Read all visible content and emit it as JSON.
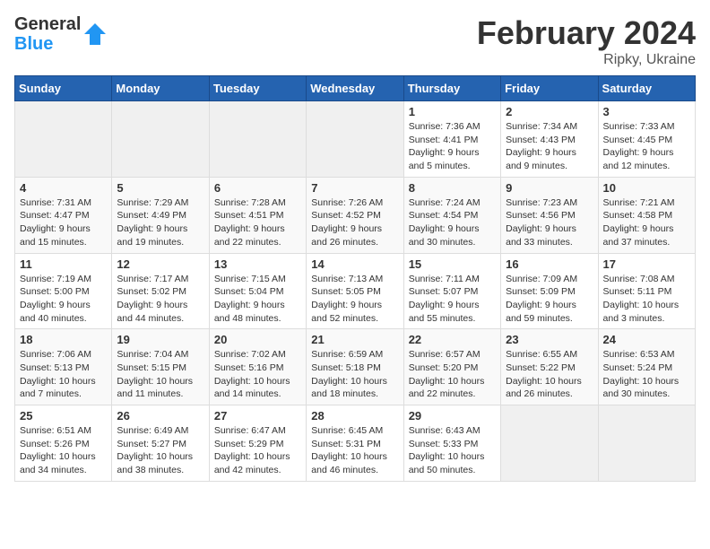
{
  "header": {
    "logo_general": "General",
    "logo_blue": "Blue",
    "title": "February 2024",
    "location": "Ripky, Ukraine"
  },
  "calendar": {
    "days_of_week": [
      "Sunday",
      "Monday",
      "Tuesday",
      "Wednesday",
      "Thursday",
      "Friday",
      "Saturday"
    ],
    "weeks": [
      [
        {
          "day": "",
          "info": ""
        },
        {
          "day": "",
          "info": ""
        },
        {
          "day": "",
          "info": ""
        },
        {
          "day": "",
          "info": ""
        },
        {
          "day": "1",
          "info": "Sunrise: 7:36 AM\nSunset: 4:41 PM\nDaylight: 9 hours\nand 5 minutes."
        },
        {
          "day": "2",
          "info": "Sunrise: 7:34 AM\nSunset: 4:43 PM\nDaylight: 9 hours\nand 9 minutes."
        },
        {
          "day": "3",
          "info": "Sunrise: 7:33 AM\nSunset: 4:45 PM\nDaylight: 9 hours\nand 12 minutes."
        }
      ],
      [
        {
          "day": "4",
          "info": "Sunrise: 7:31 AM\nSunset: 4:47 PM\nDaylight: 9 hours\nand 15 minutes."
        },
        {
          "day": "5",
          "info": "Sunrise: 7:29 AM\nSunset: 4:49 PM\nDaylight: 9 hours\nand 19 minutes."
        },
        {
          "day": "6",
          "info": "Sunrise: 7:28 AM\nSunset: 4:51 PM\nDaylight: 9 hours\nand 22 minutes."
        },
        {
          "day": "7",
          "info": "Sunrise: 7:26 AM\nSunset: 4:52 PM\nDaylight: 9 hours\nand 26 minutes."
        },
        {
          "day": "8",
          "info": "Sunrise: 7:24 AM\nSunset: 4:54 PM\nDaylight: 9 hours\nand 30 minutes."
        },
        {
          "day": "9",
          "info": "Sunrise: 7:23 AM\nSunset: 4:56 PM\nDaylight: 9 hours\nand 33 minutes."
        },
        {
          "day": "10",
          "info": "Sunrise: 7:21 AM\nSunset: 4:58 PM\nDaylight: 9 hours\nand 37 minutes."
        }
      ],
      [
        {
          "day": "11",
          "info": "Sunrise: 7:19 AM\nSunset: 5:00 PM\nDaylight: 9 hours\nand 40 minutes."
        },
        {
          "day": "12",
          "info": "Sunrise: 7:17 AM\nSunset: 5:02 PM\nDaylight: 9 hours\nand 44 minutes."
        },
        {
          "day": "13",
          "info": "Sunrise: 7:15 AM\nSunset: 5:04 PM\nDaylight: 9 hours\nand 48 minutes."
        },
        {
          "day": "14",
          "info": "Sunrise: 7:13 AM\nSunset: 5:05 PM\nDaylight: 9 hours\nand 52 minutes."
        },
        {
          "day": "15",
          "info": "Sunrise: 7:11 AM\nSunset: 5:07 PM\nDaylight: 9 hours\nand 55 minutes."
        },
        {
          "day": "16",
          "info": "Sunrise: 7:09 AM\nSunset: 5:09 PM\nDaylight: 9 hours\nand 59 minutes."
        },
        {
          "day": "17",
          "info": "Sunrise: 7:08 AM\nSunset: 5:11 PM\nDaylight: 10 hours\nand 3 minutes."
        }
      ],
      [
        {
          "day": "18",
          "info": "Sunrise: 7:06 AM\nSunset: 5:13 PM\nDaylight: 10 hours\nand 7 minutes."
        },
        {
          "day": "19",
          "info": "Sunrise: 7:04 AM\nSunset: 5:15 PM\nDaylight: 10 hours\nand 11 minutes."
        },
        {
          "day": "20",
          "info": "Sunrise: 7:02 AM\nSunset: 5:16 PM\nDaylight: 10 hours\nand 14 minutes."
        },
        {
          "day": "21",
          "info": "Sunrise: 6:59 AM\nSunset: 5:18 PM\nDaylight: 10 hours\nand 18 minutes."
        },
        {
          "day": "22",
          "info": "Sunrise: 6:57 AM\nSunset: 5:20 PM\nDaylight: 10 hours\nand 22 minutes."
        },
        {
          "day": "23",
          "info": "Sunrise: 6:55 AM\nSunset: 5:22 PM\nDaylight: 10 hours\nand 26 minutes."
        },
        {
          "day": "24",
          "info": "Sunrise: 6:53 AM\nSunset: 5:24 PM\nDaylight: 10 hours\nand 30 minutes."
        }
      ],
      [
        {
          "day": "25",
          "info": "Sunrise: 6:51 AM\nSunset: 5:26 PM\nDaylight: 10 hours\nand 34 minutes."
        },
        {
          "day": "26",
          "info": "Sunrise: 6:49 AM\nSunset: 5:27 PM\nDaylight: 10 hours\nand 38 minutes."
        },
        {
          "day": "27",
          "info": "Sunrise: 6:47 AM\nSunset: 5:29 PM\nDaylight: 10 hours\nand 42 minutes."
        },
        {
          "day": "28",
          "info": "Sunrise: 6:45 AM\nSunset: 5:31 PM\nDaylight: 10 hours\nand 46 minutes."
        },
        {
          "day": "29",
          "info": "Sunrise: 6:43 AM\nSunset: 5:33 PM\nDaylight: 10 hours\nand 50 minutes."
        },
        {
          "day": "",
          "info": ""
        },
        {
          "day": "",
          "info": ""
        }
      ]
    ]
  }
}
